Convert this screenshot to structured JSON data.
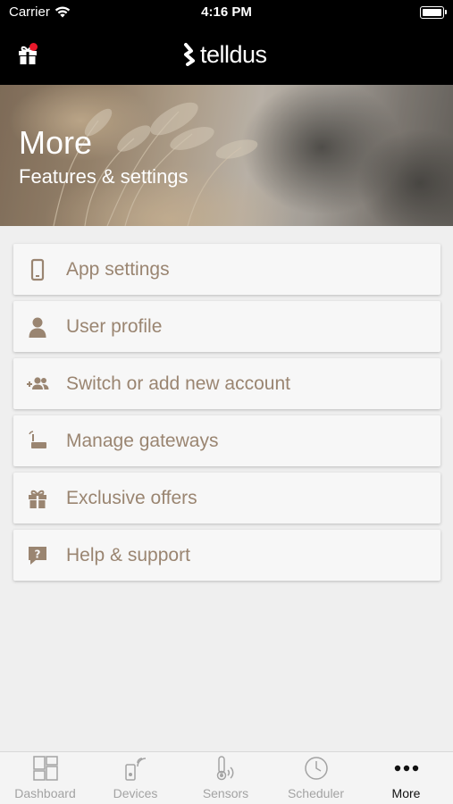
{
  "status_bar": {
    "carrier": "Carrier",
    "time": "4:16 PM"
  },
  "header": {
    "logo_text": "telldus",
    "notification_color": "#e8182a"
  },
  "hero": {
    "title": "More",
    "subtitle": "Features & settings"
  },
  "menu": {
    "accent_color": "#9a8571",
    "items": [
      {
        "label": "App settings",
        "icon": "phone-icon"
      },
      {
        "label": "User profile",
        "icon": "user-icon"
      },
      {
        "label": "Switch or add new account",
        "icon": "add-users-icon"
      },
      {
        "label": "Manage gateways",
        "icon": "gateway-icon"
      },
      {
        "label": "Exclusive offers",
        "icon": "gift-icon"
      },
      {
        "label": "Help & support",
        "icon": "help-bubble-icon"
      }
    ]
  },
  "tab_bar": {
    "tabs": [
      {
        "label": "Dashboard",
        "icon": "dashboard-icon",
        "active": false
      },
      {
        "label": "Devices",
        "icon": "devices-icon",
        "active": false
      },
      {
        "label": "Sensors",
        "icon": "sensors-icon",
        "active": false
      },
      {
        "label": "Scheduler",
        "icon": "clock-icon",
        "active": false
      },
      {
        "label": "More",
        "icon": "more-dots-icon",
        "active": true
      }
    ]
  }
}
